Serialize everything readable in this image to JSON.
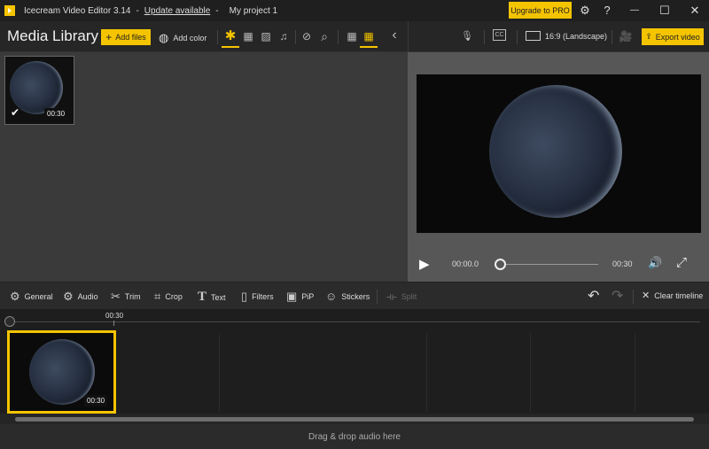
{
  "titlebar": {
    "app_name": "Icecream Video Editor 3.14",
    "separator": "-",
    "update_link": "Update available",
    "project_name": "My project 1",
    "upgrade_label": "Upgrade to PRO",
    "settings_icon": "⚙",
    "help_icon": "?",
    "minimize_icon": "—",
    "maximize_icon": "☐",
    "close_icon": "✕"
  },
  "library_toolbar": {
    "title": "Media Library",
    "add_files_label": "Add files",
    "add_files_icon": "+",
    "add_color_label": "Add color",
    "add_color_icon": "◍",
    "filter_all_icon": "✱",
    "filter_video_icon": "▦",
    "filter_image_icon": "▨",
    "filter_audio_icon": "♫",
    "unused_icon": "⊘",
    "search_icon": "⌕",
    "view_large_icon": "▦",
    "view_small_icon": "▦",
    "collapse_icon": "‹"
  },
  "preview_toolbar": {
    "mic_icon": "🎙",
    "subtitles_icon": "CC",
    "aspect_ratio_label": "16:9 (Landscape)",
    "camera_icon": "🎥",
    "export_label": "Export video",
    "export_icon": "⇪"
  },
  "library": {
    "items": [
      {
        "duration": "00:30",
        "selected": true,
        "check_icon": "✔"
      }
    ]
  },
  "player": {
    "play_icon": "▶",
    "current_time": "00:00.0",
    "total_time": "00:30",
    "progress": 0,
    "volume_icon": "🔊",
    "fullscreen_icon": "⤢"
  },
  "edit_toolbar": {
    "tools": [
      {
        "label": "General",
        "icon": "⚙"
      },
      {
        "label": "Audio",
        "icon": "⚙"
      },
      {
        "label": "Trim",
        "icon": "✂"
      },
      {
        "label": "Crop",
        "icon": "⌗"
      },
      {
        "label": "Text",
        "icon": "T"
      },
      {
        "label": "Filters",
        "icon": "▯"
      },
      {
        "label": "PiP",
        "icon": "▣"
      },
      {
        "label": "Stickers",
        "icon": "☺"
      },
      {
        "label": "Split",
        "icon": "⟛"
      }
    ],
    "undo_icon": "↶",
    "redo_icon": "↷",
    "clear_label": "Clear timeline",
    "clear_icon": "✕"
  },
  "timeline": {
    "marker_label": "00:30",
    "clips": [
      {
        "duration": "00:30"
      }
    ]
  },
  "audio_track": {
    "placeholder": "Drag & drop audio here"
  },
  "colors": {
    "accent": "#f5c400",
    "background": "#1e1e1e",
    "library_bg": "#3a3a3a",
    "preview_bg": "#575757"
  }
}
